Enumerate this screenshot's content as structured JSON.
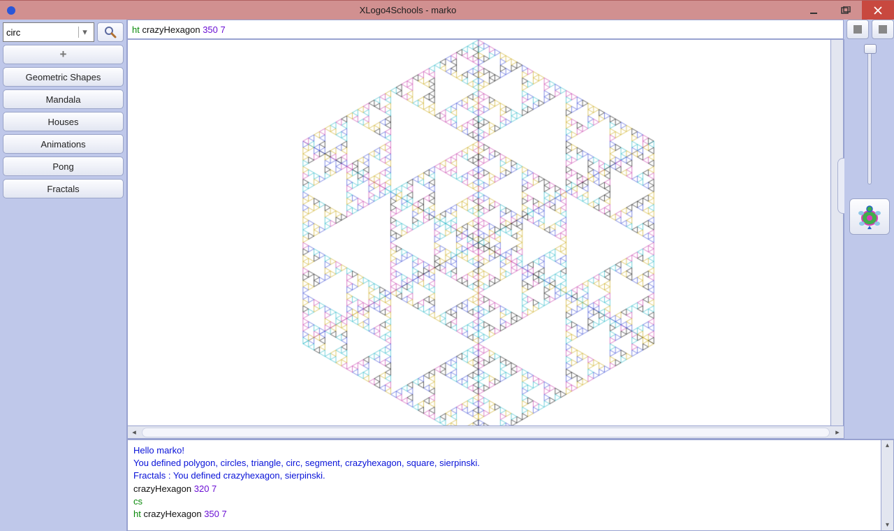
{
  "window": {
    "title": "XLogo4Schools - marko"
  },
  "combo": {
    "value": "circ"
  },
  "categories": {
    "add_label": "+",
    "items": [
      "Geometric Shapes",
      "Mandala",
      "Houses",
      "Animations",
      "Pong",
      "Fractals"
    ]
  },
  "command": {
    "kw": "ht",
    "name": "crazyHexagon",
    "args": "350 7"
  },
  "console": {
    "lines": [
      {
        "type": "msg",
        "text": "Hello marko!"
      },
      {
        "type": "msg",
        "text": "You defined polygon, circles, triangle, circ, segment, crazyhexagon, square, sierpinski."
      },
      {
        "type": "msg",
        "text": "Fractals : You defined crazyhexagon, sierpinski."
      },
      {
        "type": "cmd",
        "name": "crazyHexagon",
        "args": "320 7"
      },
      {
        "type": "kw",
        "text": "cs"
      },
      {
        "type": "cmd2",
        "kw": "ht",
        "name": "crazyHexagon",
        "args": "350 7"
      }
    ]
  },
  "colors": {
    "accent": "#bfc8ea"
  }
}
